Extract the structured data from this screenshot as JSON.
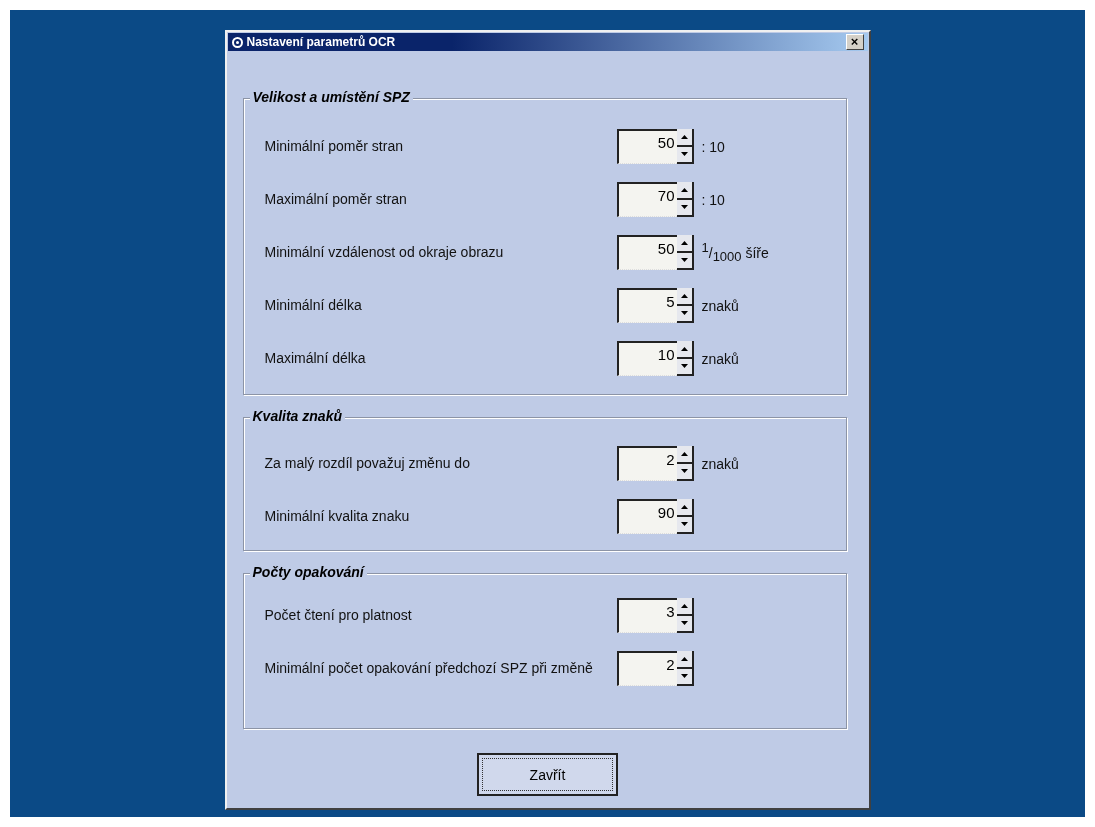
{
  "window": {
    "title": "Nastavení parametrů OCR",
    "close": "×"
  },
  "groups": [
    {
      "title": "Velikost a umístění SPZ",
      "rows": [
        {
          "label": "Minimální poměr stran",
          "value": "50",
          "unit": ": 10"
        },
        {
          "label": "Maximální poměr stran",
          "value": "70",
          "unit": ": 10"
        },
        {
          "label": "Minimální vzdálenost od okraje obrazu",
          "value": "50",
          "unit": "$^{1}$/$_{1000}$ šíře"
        },
        {
          "label": "Minimální délka",
          "value": "5",
          "unit": "znaků"
        },
        {
          "label": "Maximální délka",
          "value": "10",
          "unit": "znaků"
        }
      ]
    },
    {
      "title": "Kvalita znaků",
      "rows": [
        {
          "label": "Za malý rozdíl považuj změnu do",
          "value": "2",
          "unit": "znaků"
        },
        {
          "label": "Minimální kvalita znaku",
          "value": "90"
        }
      ]
    },
    {
      "title": "Počty opakování",
      "rows": [
        {
          "label": "Počet čtení pro platnost",
          "value": "3"
        },
        {
          "label": "Minimální počet opakování předchozí SPZ při změně",
          "value": "2"
        }
      ]
    }
  ],
  "buttons": [
    "Zavřít"
  ]
}
